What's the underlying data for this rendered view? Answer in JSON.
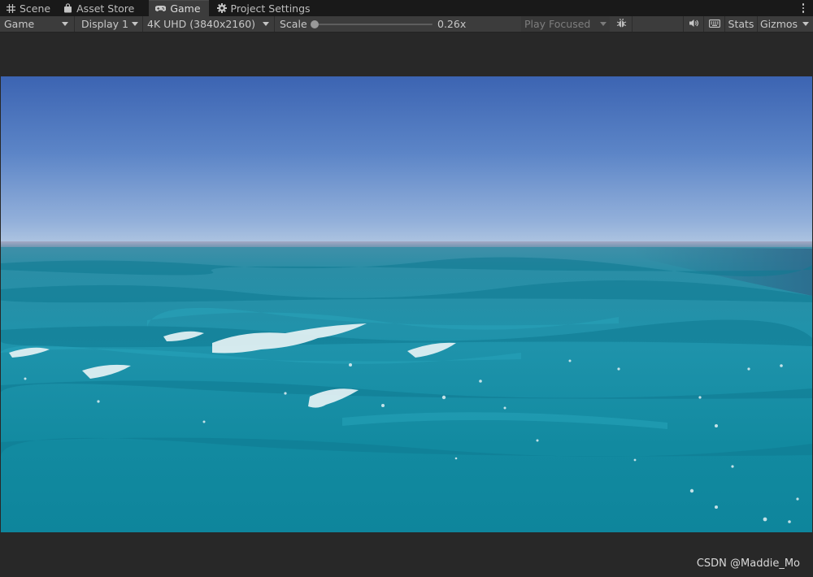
{
  "tabs": [
    {
      "label": "Scene",
      "icon": "grid-icon",
      "active": false
    },
    {
      "label": "Asset Store",
      "icon": "shopping-bag-icon",
      "active": false
    },
    {
      "label": "Game",
      "icon": "gamepad-icon",
      "active": true
    },
    {
      "label": "Project Settings",
      "icon": "gear-icon",
      "active": false
    }
  ],
  "toolbar": {
    "view_dropdown": "Game",
    "display_dropdown": "Display 1",
    "resolution_dropdown": "4K UHD (3840x2160)",
    "scale_label": "Scale",
    "scale_value": "0.26x",
    "scale_fraction": 0.0,
    "play_mode_dropdown": "Play Focused",
    "stats_label": "Stats",
    "gizmos_label": "Gizmos"
  },
  "game_view": {
    "scene": "ocean-waves-under-blue-sky",
    "sky_top_color": "#3c66b4",
    "sky_horizon_color": "#a9bfdc",
    "water_color": "#17889f"
  },
  "watermark": "CSDN @Maddie_Mo"
}
